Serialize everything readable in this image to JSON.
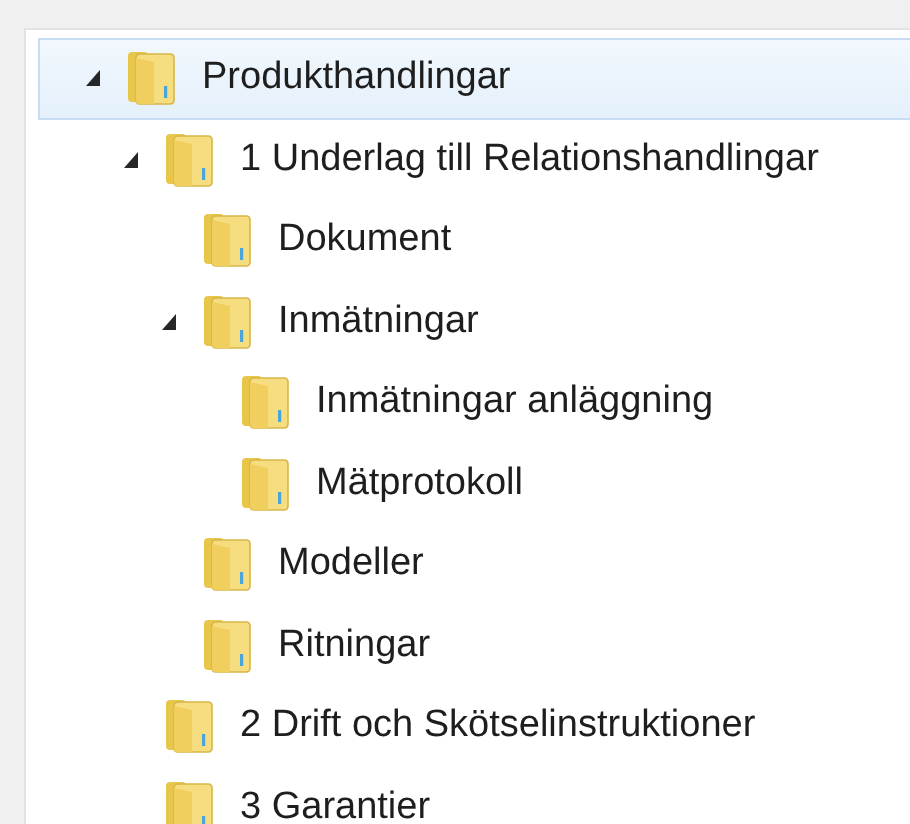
{
  "tree": [
    {
      "label": "Produkthandlingar",
      "selected": true,
      "expanded": true,
      "children": [
        {
          "label": "1 Underlag till Relationshandlingar",
          "selected": false,
          "expanded": true,
          "children": [
            {
              "label": "Dokument",
              "selected": false
            },
            {
              "label": "Inmätningar",
              "selected": false,
              "expanded": true,
              "children": [
                {
                  "label": "Inmätningar anläggning",
                  "selected": false
                },
                {
                  "label": "Mätprotokoll",
                  "selected": false
                }
              ]
            },
            {
              "label": "Modeller",
              "selected": false
            },
            {
              "label": "Ritningar",
              "selected": false
            }
          ]
        },
        {
          "label": "2 Drift och Skötselinstruktioner",
          "selected": false
        },
        {
          "label": "3 Garantier",
          "selected": false
        }
      ]
    }
  ]
}
